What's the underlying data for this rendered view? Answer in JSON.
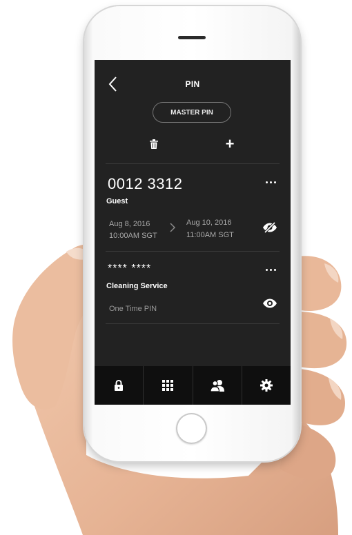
{
  "header": {
    "title": "PIN",
    "back_icon": "chevron-left-icon"
  },
  "master_pin_label": "MASTER PIN",
  "toolbar": {
    "delete_icon": "trash-icon",
    "add_label": "+"
  },
  "pins": [
    {
      "code": "0012 3312",
      "name": "Guest",
      "start_date": "Aug 8, 2016",
      "start_time": "10:00AM SGT",
      "end_date": "Aug 10, 2016",
      "end_time": "11:00AM SGT",
      "visibility_icon": "eye-off-icon"
    },
    {
      "code": "**** ****",
      "name": "Cleaning Service",
      "type": "One Time PIN",
      "visibility_icon": "eye-icon"
    }
  ],
  "tabs": [
    {
      "icon": "lock-icon"
    },
    {
      "icon": "keypad-icon"
    },
    {
      "icon": "users-icon"
    },
    {
      "icon": "gear-icon"
    }
  ],
  "colors": {
    "screen_bg": "#222222",
    "tabbar_bg": "#0f0f0f",
    "muted_text": "#a9a9a9"
  }
}
